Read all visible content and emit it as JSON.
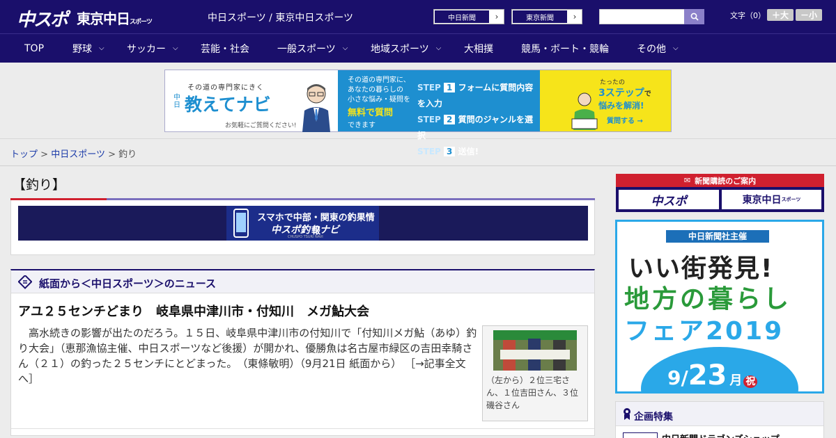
{
  "header": {
    "logo_chuspo": "中スポ",
    "logo_tokyo": "東京中日",
    "logo_tokyo_small": "スポーツ",
    "site_title": "中日スポーツ / 東京中日スポーツ",
    "paper_buttons": [
      {
        "label": "中日新聞"
      },
      {
        "label": "東京新聞"
      }
    ],
    "search_placeholder": "",
    "font_size_label": "文字（0）",
    "font_plus": "＋大",
    "font_minus": "－小"
  },
  "nav": {
    "items": [
      {
        "label": "TOP",
        "dropdown": false
      },
      {
        "label": "野球",
        "dropdown": true
      },
      {
        "label": "サッカー",
        "dropdown": true
      },
      {
        "label": "芸能・社会",
        "dropdown": false
      },
      {
        "label": "一般スポーツ",
        "dropdown": true
      },
      {
        "label": "地域スポーツ",
        "dropdown": true
      },
      {
        "label": "大相撲",
        "dropdown": false
      },
      {
        "label": "競馬・ボート・競輪",
        "dropdown": false
      },
      {
        "label": "その他",
        "dropdown": true
      }
    ]
  },
  "ad_banner": {
    "tagline": "その道の専門家にきく",
    "brand_small": "中日",
    "brand": "教えてナビ",
    "sub": "お気軽にご質問ください!",
    "mid_lines": [
      "その道の専門家に、",
      "あなたの暮らしの",
      "小さな悩み・疑問を"
    ],
    "mid_highlight": "無料で質問",
    "mid_end": "できます",
    "steps": [
      {
        "n": "1",
        "text": "フォームに質問内容を入力"
      },
      {
        "n": "2",
        "text": "質問のジャンルを選択"
      },
      {
        "n": "3",
        "text": "送信!"
      }
    ],
    "step_word": "STEP",
    "right_small": "たったの",
    "right_big": "3ステップ",
    "right_de": "で",
    "right_solve": "悩みを解消!",
    "right_btn": "質問する"
  },
  "breadcrumb": {
    "home": "トップ",
    "section": "中日スポーツ",
    "current": "釣り",
    "sep": ">"
  },
  "main": {
    "heading": "【釣り】",
    "turi_banner_title": "スマホで中部・関東の釣果情報",
    "turi_banner_brand": "中スポ釣りナビ",
    "turi_banner_small": "CHUSPO TSURI NAVI",
    "news_heading": "紙面から＜中日スポーツ＞のニュース",
    "article": {
      "title": "アユ２５センチどまり　岐阜県中津川市・付知川　メガ鮎大会",
      "body": "　高水続きの影響が出たのだろう。１５日、岐阜県中津川市の付知川で「付知川メガ鮎（あゆ）釣り大会」（恵那漁協主催、中日スポーツなど後援）が開かれ、優勝魚は名古屋市緑区の吉田幸騎さん（２１）の釣った２５センチにとどまった。　（東條敏明）（9月21日 紙面から）",
      "more_link": "［→記事全文へ］",
      "caption": "（左から）２位三宅さん、１位吉田さん、３位磯谷さん"
    }
  },
  "sidebar": {
    "subscribe_head": "新聞購読のご案内",
    "sub_logo_1": "中スポ",
    "sub_logo_2": "東京中日",
    "sub_logo_2_small": "スポーツ",
    "fair": {
      "organizer": "中日新聞社主催",
      "line1": "いい街発見!",
      "line2": "地方の暮らし",
      "line3": "フェア2019",
      "date_month": "9",
      "date_sep": "/",
      "date_day": "23",
      "date_wday": "月",
      "date_holiday": "祝"
    },
    "kikaku_title": "企画特集",
    "kikaku_item": "中日新聞ドラゴンズショップ"
  },
  "colors": {
    "brand_navy": "#1a0f6b",
    "accent_red": "#d0202f",
    "accent_purple": "#7a6fbd",
    "ad_blue": "#1e8fd0",
    "ad_yellow": "#f6e41a",
    "fair_blue": "#2aa8e8"
  }
}
